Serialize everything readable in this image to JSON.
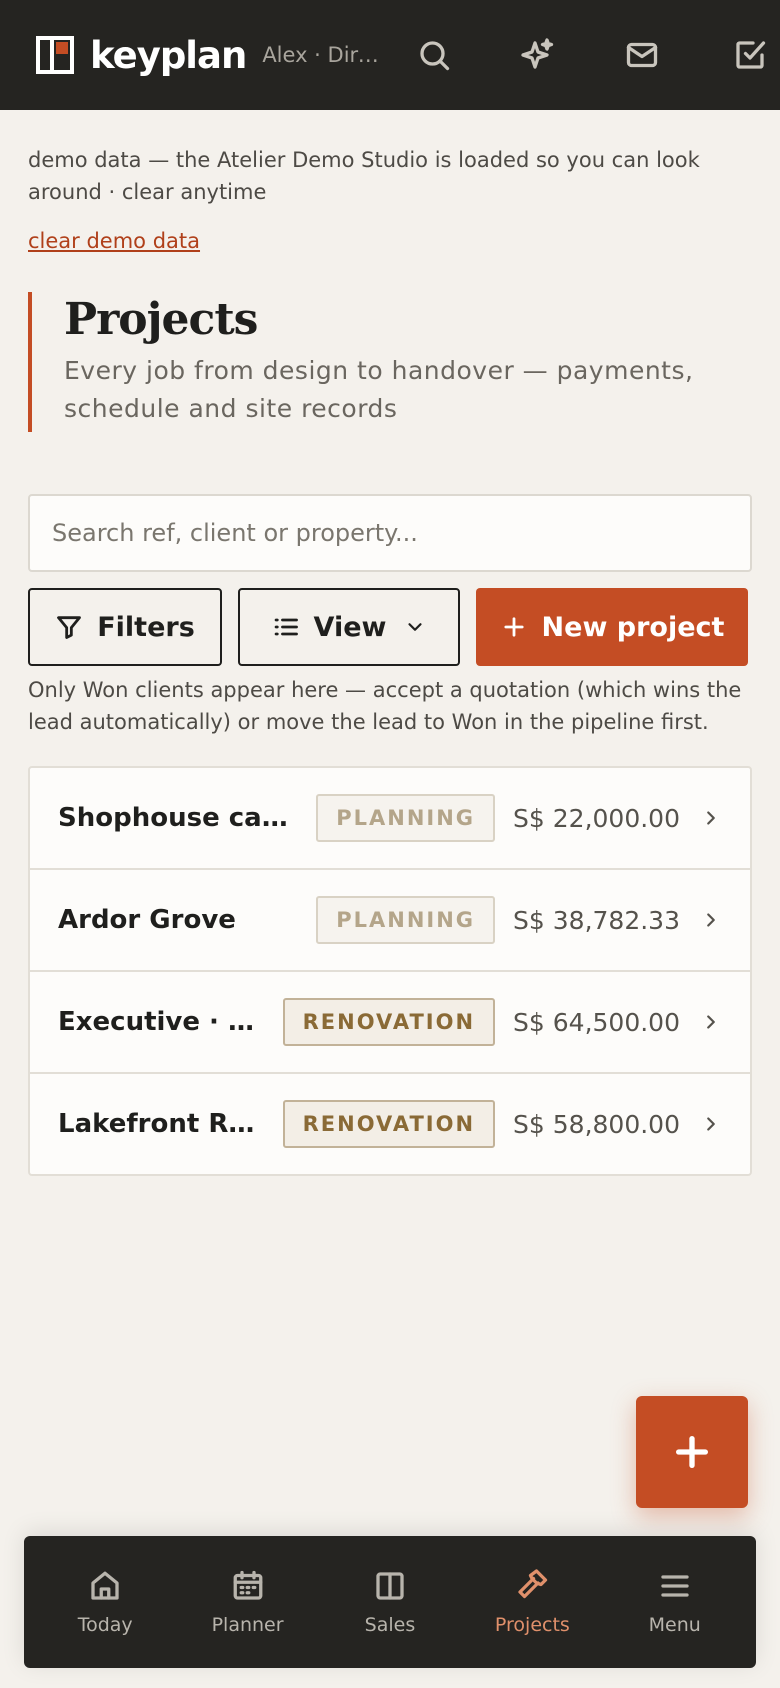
{
  "header": {
    "brand": "keyplan",
    "user": "Alex · Director",
    "icons": [
      "search-icon",
      "sparkle-icon",
      "mail-icon",
      "tasks-icon"
    ]
  },
  "demo": {
    "text": "demo data — the Atelier Demo Studio is loaded so you can look around · clear anytime",
    "link": "clear demo data"
  },
  "page": {
    "title": "Projects",
    "subtitle": "Every job from design to handover — payments, schedule and site records"
  },
  "search": {
    "placeholder": "Search ref, client or property..."
  },
  "actions": {
    "filters": "Filters",
    "view": "View",
    "new_project": "New project"
  },
  "hint": "Only Won clients appear here — accept a quotation (which wins the lead automatically) or move the lead to Won in the pipeline first.",
  "projects": [
    {
      "name": "Shophouse cafe · Joo Chiat",
      "status": "PLANNING",
      "amount": "S$ 22,000.00"
    },
    {
      "name": "Ardor Grove",
      "status": "PLANNING",
      "amount": "S$ 38,782.33"
    },
    {
      "name": "Executive · Pasir Ris",
      "status": "RENOVATION",
      "amount": "S$ 64,500.00"
    },
    {
      "name": "Lakefront Residences",
      "status": "RENOVATION",
      "amount": "S$ 58,800.00"
    }
  ],
  "nav": [
    {
      "label": "Today",
      "icon": "home-icon"
    },
    {
      "label": "Planner",
      "icon": "calendar-icon"
    },
    {
      "label": "Sales",
      "icon": "columns-icon"
    },
    {
      "label": "Projects",
      "icon": "hammer-icon",
      "active": true
    },
    {
      "label": "Menu",
      "icon": "menu-icon"
    }
  ],
  "colors": {
    "accent": "#c44d24",
    "topbar": "#252421",
    "background": "#f4f1ec",
    "active_nav": "#e0906b"
  }
}
